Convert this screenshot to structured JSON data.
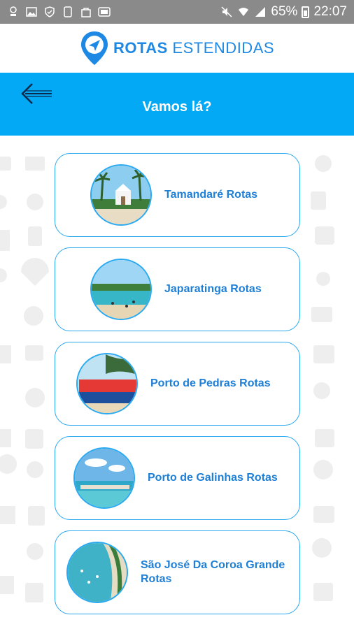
{
  "status_bar": {
    "battery": "65%",
    "time": "22:07",
    "left_icons": [
      "notification-icon",
      "image-icon",
      "shield-icon",
      "device-icon",
      "bag-icon",
      "app-icon"
    ],
    "right_icons": [
      "mute-icon",
      "wifi-icon",
      "signal-icon",
      "battery-icon"
    ]
  },
  "logo": {
    "word1": "ROTAS",
    "word2": "ESTENDIDAS",
    "color": "#1e88e5"
  },
  "header": {
    "title": "Vamos lá?",
    "background": "#03a9f4"
  },
  "destinations": [
    {
      "label": "Tamandaré Rotas",
      "thumb": "tamandare-photo"
    },
    {
      "label": "Japaratinga Rotas",
      "thumb": "japaratinga-photo"
    },
    {
      "label": "Porto de Pedras Rotas",
      "thumb": "porto-de-pedras-photo"
    },
    {
      "label": "Porto de Galinhas Rotas",
      "thumb": "porto-de-galinhas-photo"
    },
    {
      "label": "São José Da Coroa Grande Rotas",
      "thumb": "sao-jose-photo"
    }
  ]
}
